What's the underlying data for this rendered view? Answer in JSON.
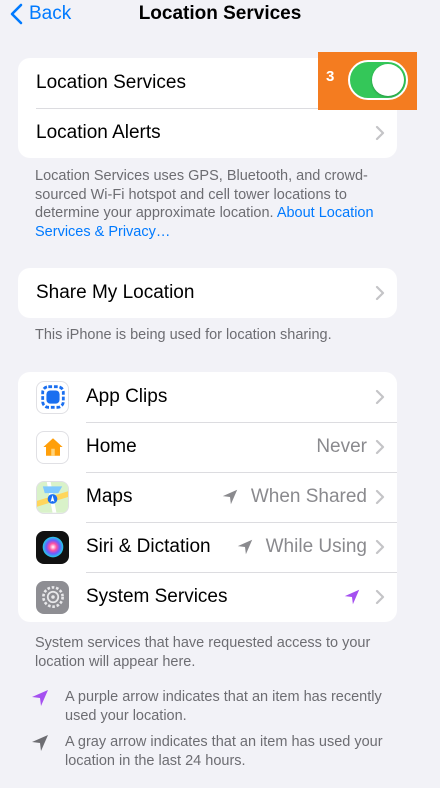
{
  "nav": {
    "back_label": "Back",
    "title": "Location Services"
  },
  "group1": {
    "location_services_label": "Location Services",
    "location_alerts_label": "Location Alerts",
    "toggle_on": true,
    "annotation_badge": "3"
  },
  "footer1": {
    "text": "Location Services uses GPS, Bluetooth, and crowd-sourced Wi-Fi hotspot and cell tower locations to determine your approximate location. ",
    "link": "About Location Services & Privacy…"
  },
  "group2": {
    "share_label": "Share My Location"
  },
  "footer2": {
    "text": "This iPhone is being used for location sharing."
  },
  "apps": [
    {
      "label": "App Clips",
      "value": "",
      "icon": "app-clips-icon"
    },
    {
      "label": "Home",
      "value": "Never",
      "icon": "home-icon"
    },
    {
      "label": "Maps",
      "value": "When Shared",
      "icon": "maps-icon",
      "arrow": "gray"
    },
    {
      "label": "Siri & Dictation",
      "value": "While Using",
      "icon": "siri-icon",
      "arrow": "gray"
    },
    {
      "label": "System Services",
      "value": "",
      "icon": "settings-gear-icon",
      "arrow": "purple"
    }
  ],
  "footer3": {
    "text": "System services that have requested access to your location will appear here."
  },
  "legend": {
    "purple_text": "A purple arrow indicates that an item has recently used your location.",
    "gray_text": "A gray arrow indicates that an item has used your location in the last 24 hours."
  },
  "colors": {
    "accent": "#007aff",
    "toggle_on": "#34c759",
    "annotation": "#f47c20",
    "purple_arrow": "#a550f0",
    "gray_arrow": "#8a8a8e"
  }
}
